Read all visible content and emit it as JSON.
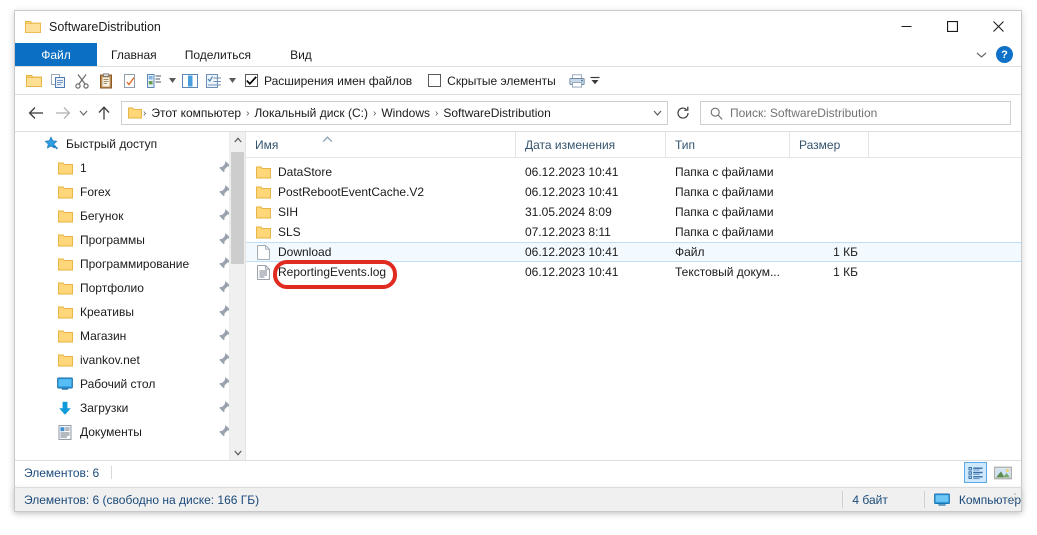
{
  "window": {
    "title": "SoftwareDistribution",
    "title_icon": "folder-icon",
    "minimize_glyph": "—",
    "maximize_glyph": "□",
    "close_glyph": "✕",
    "ribbon_collapse_glyph": "˅",
    "help_glyph": "?"
  },
  "ribbon": {
    "tabs": [
      {
        "label": "Файл",
        "active": true
      },
      {
        "label": "Главная",
        "active": false
      },
      {
        "label": "Поделиться",
        "active": false
      },
      {
        "label": "Вид",
        "active": false
      }
    ]
  },
  "quick_toolbar": {
    "icons": [
      "new-folder-icon",
      "copy-icon",
      "cut-icon",
      "paste-icon",
      "rename-icon",
      "properties-icon",
      "preview-pane-icon",
      "select-options-icon",
      "printer-icon",
      "customize-dropdown-icon"
    ],
    "checkbox_file_extensions": {
      "label": "Расширения имен файлов",
      "checked": true
    },
    "checkbox_hidden_items": {
      "label": "Скрытые элементы",
      "checked": false
    }
  },
  "address": {
    "back_glyph": "←",
    "forward_glyph": "→",
    "recent_glyph": "˅",
    "up_glyph": "↑",
    "folder_icon": "folder-icon",
    "crumbs": [
      "Этот компьютер",
      "Локальный диск (C:)",
      "Windows",
      "SoftwareDistribution"
    ],
    "separator": "›",
    "dropdown_glyph": "˅",
    "refresh_glyph": "↻"
  },
  "search": {
    "icon": "search-icon",
    "placeholder": "Поиск: SoftwareDistribution",
    "value": ""
  },
  "sidebar": {
    "root": {
      "label": "Быстрый доступ",
      "icon": "star-pin-icon"
    },
    "items": [
      {
        "label": "1",
        "icon": "folder-icon",
        "pinned": true
      },
      {
        "label": "Forex",
        "icon": "folder-icon",
        "pinned": true
      },
      {
        "label": "Бегунок",
        "icon": "folder-icon",
        "pinned": true
      },
      {
        "label": "Программы",
        "icon": "folder-icon",
        "pinned": true
      },
      {
        "label": "Программирование",
        "icon": "folder-icon",
        "pinned": true
      },
      {
        "label": "Портфолио",
        "icon": "folder-icon",
        "pinned": true
      },
      {
        "label": "Креативы",
        "icon": "folder-icon",
        "pinned": true
      },
      {
        "label": "Магазин",
        "icon": "folder-icon",
        "pinned": true
      },
      {
        "label": "ivankov.net",
        "icon": "folder-icon",
        "pinned": true
      },
      {
        "label": "Рабочий стол",
        "icon": "desktop-icon",
        "pinned": true
      },
      {
        "label": "Загрузки",
        "icon": "downloads-icon",
        "pinned": true
      },
      {
        "label": "Документы",
        "icon": "documents-icon",
        "pinned": true
      }
    ],
    "scroll_up_glyph": "˄",
    "scroll_down_glyph": "˅"
  },
  "filelist": {
    "columns": [
      {
        "key": "name",
        "label": "Имя"
      },
      {
        "key": "date",
        "label": "Дата изменения"
      },
      {
        "key": "type",
        "label": "Тип"
      },
      {
        "key": "size",
        "label": "Размер"
      }
    ],
    "sort_indicator": "˄",
    "rows": [
      {
        "name": "DataStore",
        "date": "06.12.2023 10:41",
        "type": "Папка с файлами",
        "size": "",
        "icon": "folder-icon",
        "selected": false,
        "highlighted": false
      },
      {
        "name": "PostRebootEventCache.V2",
        "date": "06.12.2023 10:41",
        "type": "Папка с файлами",
        "size": "",
        "icon": "folder-icon",
        "selected": false,
        "highlighted": false
      },
      {
        "name": "SIH",
        "date": "31.05.2024 8:09",
        "type": "Папка с файлами",
        "size": "",
        "icon": "folder-icon",
        "selected": false,
        "highlighted": false
      },
      {
        "name": "SLS",
        "date": "07.12.2023 8:11",
        "type": "Папка с файлами",
        "size": "",
        "icon": "folder-icon",
        "selected": false,
        "highlighted": false
      },
      {
        "name": "Download",
        "date": "06.12.2023 10:41",
        "type": "Файл",
        "size": "1 КБ",
        "icon": "file-blank-icon",
        "selected": true,
        "highlighted": true
      },
      {
        "name": "ReportingEvents.log",
        "date": "06.12.2023 10:41",
        "type": "Текстовый докум...",
        "size": "1 КБ",
        "icon": "log-file-icon",
        "selected": false,
        "highlighted": false
      }
    ]
  },
  "countbar": {
    "text": "Элементов: 6",
    "view_details_icon": "details-view-icon",
    "view_large_icons_icon": "large-icons-view-icon"
  },
  "statusbar": {
    "items_text": "Элементов: 6 (свободно на диске: 166 ГБ)",
    "bytes_text": "4 байт",
    "location_text": "Компьютер",
    "location_icon": "computer-icon"
  },
  "annotation": {
    "highlight_color": "#e02b20",
    "target": "Download"
  },
  "colors": {
    "accent": "#0b6fc4",
    "folder": "#ffd778",
    "selection": "#f2f9ff",
    "selection_border": "#bcdffb",
    "column_header_text": "#34546e",
    "status_text": "#1b4a7a"
  }
}
